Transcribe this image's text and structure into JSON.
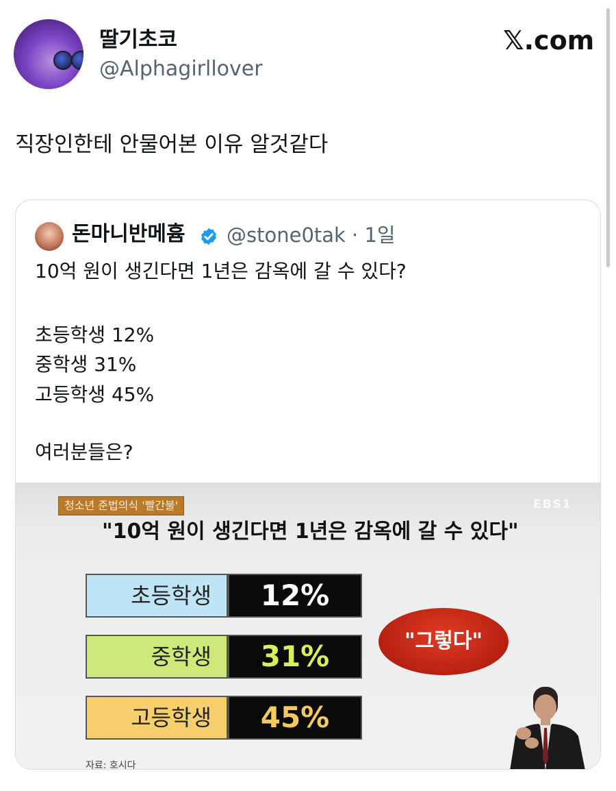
{
  "author": {
    "display_name": "딸기초코",
    "handle": "@Alphagirllover"
  },
  "site_mark": "𝕏.com",
  "tweet": {
    "text": "직장인한테 안물어본 이유 알것같다"
  },
  "quoted_tweet": {
    "display_name": "돈마니반메흄",
    "handle_time": "@stone0tak · 1일",
    "lines": [
      "10억 원이 생긴다면 1년은 감옥에 갈 수 있다?",
      "초등학생 12%",
      "중학생 31%",
      "고등학생 45%",
      "여러분들은?"
    ],
    "media": {
      "tag": "청소년 준법의식 '빨간불'",
      "broadcaster": "EBS1",
      "headline": "\"10억 원이 생긴다면 1년은 감옥에 갈 수 있다\"",
      "bars": [
        {
          "label": "초등학생",
          "value": "12%",
          "label_color": "#bfe4f5",
          "value_color": "#ffffff"
        },
        {
          "label": "중학생",
          "value": "31%",
          "label_color": "#cfe87a",
          "value_color": "#d9ee5a"
        },
        {
          "label": "고등학생",
          "value": "45%",
          "label_color": "#f6cf6c",
          "value_color": "#f4c95d"
        }
      ],
      "callout": "\"그렇다\"",
      "source_partial": "자료: 호시다"
    }
  },
  "colors": {
    "verified": "#1d9bf0",
    "secondary_text": "#536471",
    "callout_red": "#c32415"
  }
}
